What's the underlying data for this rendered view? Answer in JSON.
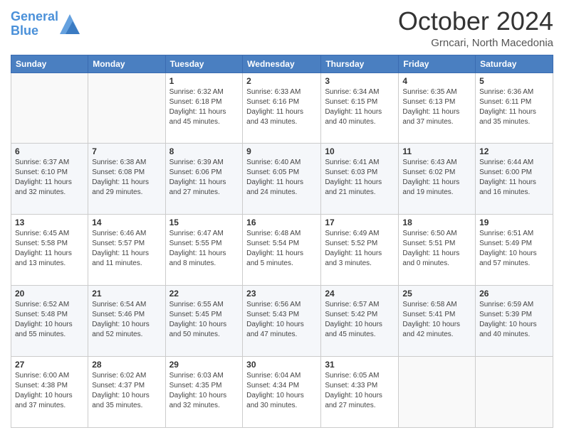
{
  "header": {
    "logo_line1": "General",
    "logo_line2": "Blue",
    "title": "October 2024",
    "subtitle": "Grncari, North Macedonia"
  },
  "columns": [
    "Sunday",
    "Monday",
    "Tuesday",
    "Wednesday",
    "Thursday",
    "Friday",
    "Saturday"
  ],
  "weeks": [
    [
      {
        "day": "",
        "info": ""
      },
      {
        "day": "",
        "info": ""
      },
      {
        "day": "1",
        "info": "Sunrise: 6:32 AM\nSunset: 6:18 PM\nDaylight: 11 hours and 45 minutes."
      },
      {
        "day": "2",
        "info": "Sunrise: 6:33 AM\nSunset: 6:16 PM\nDaylight: 11 hours and 43 minutes."
      },
      {
        "day": "3",
        "info": "Sunrise: 6:34 AM\nSunset: 6:15 PM\nDaylight: 11 hours and 40 minutes."
      },
      {
        "day": "4",
        "info": "Sunrise: 6:35 AM\nSunset: 6:13 PM\nDaylight: 11 hours and 37 minutes."
      },
      {
        "day": "5",
        "info": "Sunrise: 6:36 AM\nSunset: 6:11 PM\nDaylight: 11 hours and 35 minutes."
      }
    ],
    [
      {
        "day": "6",
        "info": "Sunrise: 6:37 AM\nSunset: 6:10 PM\nDaylight: 11 hours and 32 minutes."
      },
      {
        "day": "7",
        "info": "Sunrise: 6:38 AM\nSunset: 6:08 PM\nDaylight: 11 hours and 29 minutes."
      },
      {
        "day": "8",
        "info": "Sunrise: 6:39 AM\nSunset: 6:06 PM\nDaylight: 11 hours and 27 minutes."
      },
      {
        "day": "9",
        "info": "Sunrise: 6:40 AM\nSunset: 6:05 PM\nDaylight: 11 hours and 24 minutes."
      },
      {
        "day": "10",
        "info": "Sunrise: 6:41 AM\nSunset: 6:03 PM\nDaylight: 11 hours and 21 minutes."
      },
      {
        "day": "11",
        "info": "Sunrise: 6:43 AM\nSunset: 6:02 PM\nDaylight: 11 hours and 19 minutes."
      },
      {
        "day": "12",
        "info": "Sunrise: 6:44 AM\nSunset: 6:00 PM\nDaylight: 11 hours and 16 minutes."
      }
    ],
    [
      {
        "day": "13",
        "info": "Sunrise: 6:45 AM\nSunset: 5:58 PM\nDaylight: 11 hours and 13 minutes."
      },
      {
        "day": "14",
        "info": "Sunrise: 6:46 AM\nSunset: 5:57 PM\nDaylight: 11 hours and 11 minutes."
      },
      {
        "day": "15",
        "info": "Sunrise: 6:47 AM\nSunset: 5:55 PM\nDaylight: 11 hours and 8 minutes."
      },
      {
        "day": "16",
        "info": "Sunrise: 6:48 AM\nSunset: 5:54 PM\nDaylight: 11 hours and 5 minutes."
      },
      {
        "day": "17",
        "info": "Sunrise: 6:49 AM\nSunset: 5:52 PM\nDaylight: 11 hours and 3 minutes."
      },
      {
        "day": "18",
        "info": "Sunrise: 6:50 AM\nSunset: 5:51 PM\nDaylight: 11 hours and 0 minutes."
      },
      {
        "day": "19",
        "info": "Sunrise: 6:51 AM\nSunset: 5:49 PM\nDaylight: 10 hours and 57 minutes."
      }
    ],
    [
      {
        "day": "20",
        "info": "Sunrise: 6:52 AM\nSunset: 5:48 PM\nDaylight: 10 hours and 55 minutes."
      },
      {
        "day": "21",
        "info": "Sunrise: 6:54 AM\nSunset: 5:46 PM\nDaylight: 10 hours and 52 minutes."
      },
      {
        "day": "22",
        "info": "Sunrise: 6:55 AM\nSunset: 5:45 PM\nDaylight: 10 hours and 50 minutes."
      },
      {
        "day": "23",
        "info": "Sunrise: 6:56 AM\nSunset: 5:43 PM\nDaylight: 10 hours and 47 minutes."
      },
      {
        "day": "24",
        "info": "Sunrise: 6:57 AM\nSunset: 5:42 PM\nDaylight: 10 hours and 45 minutes."
      },
      {
        "day": "25",
        "info": "Sunrise: 6:58 AM\nSunset: 5:41 PM\nDaylight: 10 hours and 42 minutes."
      },
      {
        "day": "26",
        "info": "Sunrise: 6:59 AM\nSunset: 5:39 PM\nDaylight: 10 hours and 40 minutes."
      }
    ],
    [
      {
        "day": "27",
        "info": "Sunrise: 6:00 AM\nSunset: 4:38 PM\nDaylight: 10 hours and 37 minutes."
      },
      {
        "day": "28",
        "info": "Sunrise: 6:02 AM\nSunset: 4:37 PM\nDaylight: 10 hours and 35 minutes."
      },
      {
        "day": "29",
        "info": "Sunrise: 6:03 AM\nSunset: 4:35 PM\nDaylight: 10 hours and 32 minutes."
      },
      {
        "day": "30",
        "info": "Sunrise: 6:04 AM\nSunset: 4:34 PM\nDaylight: 10 hours and 30 minutes."
      },
      {
        "day": "31",
        "info": "Sunrise: 6:05 AM\nSunset: 4:33 PM\nDaylight: 10 hours and 27 minutes."
      },
      {
        "day": "",
        "info": ""
      },
      {
        "day": "",
        "info": ""
      }
    ]
  ]
}
